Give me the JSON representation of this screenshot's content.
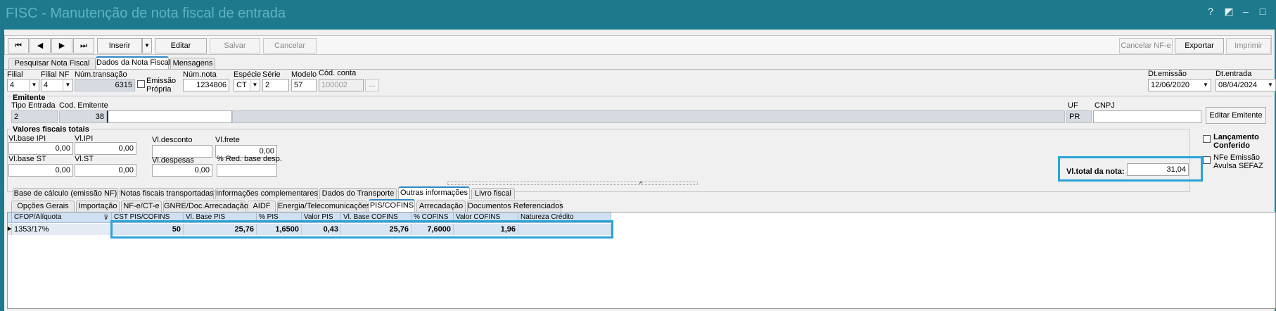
{
  "window": {
    "title": "FISC - Manutenção de nota fiscal de entrada",
    "subtitle": "..."
  },
  "toolbar": {
    "nav_first": "⏮",
    "nav_prev": "◀",
    "nav_next": "▶",
    "nav_last": "⏭",
    "insert_label": "Inserir",
    "edit_label": "Editar",
    "save_label": "Salvar",
    "cancel_label": "Cancelar",
    "cancel_nfe_label": "Cancelar NF-e",
    "export_label": "Exportar",
    "print_label": "Imprimir"
  },
  "main_tabs": [
    "Pesquisar Nota Fiscal",
    "Dados da Nota Fiscal",
    "Mensagens"
  ],
  "header_fields": {
    "filial_label": "Filial",
    "filial_value": "4",
    "filial_nf_label": "Filial NF",
    "filial_nf_value": "4",
    "num_transacao_label": "Núm.transação",
    "num_transacao_value": "6315",
    "emissao_propria_label_1": "Emissão",
    "emissao_propria_label_2": "Própria",
    "num_nota_label": "Núm.nota",
    "num_nota_value": "1234806",
    "especie_label": "Espécie",
    "especie_value": "CT",
    "serie_label": "Série",
    "serie_value": "2",
    "modelo_label": "Modelo",
    "modelo_value": "57",
    "cod_conta_label": "Cód. conta",
    "cod_conta_value": "100002",
    "ellipsis": "...",
    "dt_emissao_label": "Dt.emissão",
    "dt_emissao_value": "12/06/2020",
    "dt_entrada_label": "Dt.entrada",
    "dt_entrada_value": "08/04/2024"
  },
  "emitente": {
    "section_label": "Emitente",
    "tipo_entrada_label": "Tipo Entrada",
    "tipo_entrada_value": "2",
    "cod_emitente_label": "Cod. Emitente",
    "cod_emitente_value": "38",
    "uf_label": "UF",
    "uf_value": "PR",
    "cnpj_label": "CNPJ",
    "cnpj_value": "",
    "edit_button": "Editar Emitente"
  },
  "valores": {
    "section_label": "Valores fiscais totais",
    "base_ipi_label": "Vl.base IPI",
    "base_ipi_value": "0,00",
    "ipi_label": "Vl.IPI",
    "ipi_value": "0,00",
    "desconto_label": "Vl.desconto",
    "desconto_value": "",
    "frete_label": "Vl.frete",
    "frete_value": "0,00",
    "base_st_label": "Vl.base ST",
    "base_st_value": "0,00",
    "st_label": "Vl.ST",
    "st_value": "0,00",
    "despesas_label": "Vl.despesas",
    "despesas_value": "0,00",
    "red_base_label": "% Red. base desp.",
    "red_base_value": "",
    "total_label": "Vl.total da nota:",
    "total_value": "31,04",
    "lancamento_label_1": "Lançamento",
    "lancamento_label_2": "Conferido",
    "nfe_avulsa_label_1": "NFe Emissão",
    "nfe_avulsa_label_2": "Avulsa SEFAZ"
  },
  "sub_tabs": [
    "Base de cálculo (emissão NF)",
    "Notas fiscais transportadas",
    "Informações complementares",
    "Dados do Transporte",
    "Outras informações",
    "Livro fiscal"
  ],
  "sub_sub_tabs": [
    "Opções Gerais",
    "Importação",
    "NF-e/CT-e",
    "GNRE/Doc.Arrecadação",
    "AIDF",
    "Energia/Telecomunicações",
    "PIS/COFINS",
    "Arrecadação",
    "Documentos Referenciados"
  ],
  "grid": {
    "headers": [
      "CFOP/Alíquota",
      "CST PIS/COFINS",
      "Vl. Base PIS",
      "% PIS",
      "Valor PIS",
      "Vl. Base COFINS",
      "% COFINS",
      "Valor COFINS",
      "Natureza Crédito"
    ],
    "rows": [
      [
        "1353/17%",
        "50",
        "25,76",
        "1,6500",
        "0,43",
        "25,76",
        "7,6000",
        "1,96",
        ""
      ]
    ]
  },
  "colors": {
    "titlebar": "#1c7a8c",
    "highlight": "#29a3d9",
    "grid_header": "#cfe0f3"
  }
}
